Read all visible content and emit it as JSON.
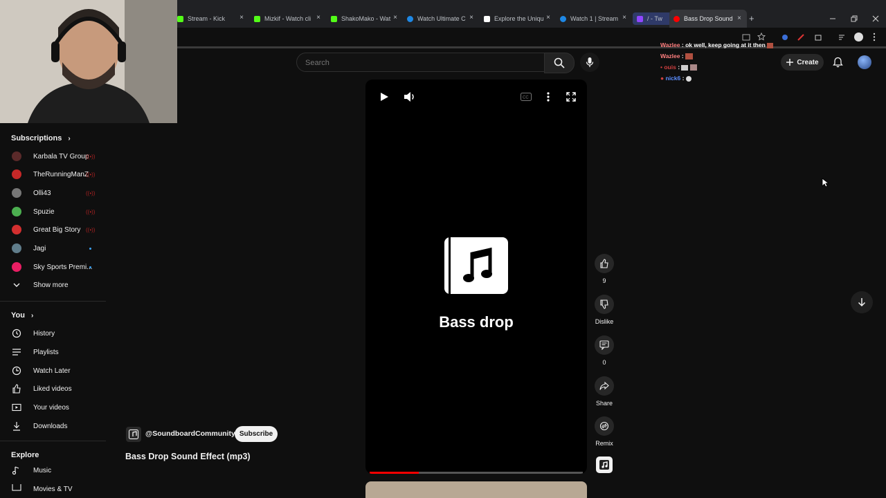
{
  "browser": {
    "tabs": [
      {
        "title": "Stream - Kick",
        "color": "#53fc18"
      },
      {
        "title": "Mizkif - Watch cli",
        "color": "#53fc18"
      },
      {
        "title": "ShakoMako - Wat",
        "color": "#53fc18"
      },
      {
        "title": "Watch Ultimate C",
        "color": "#1e88e5"
      },
      {
        "title": "Explore the Uniqu",
        "color": "#ffffff"
      },
      {
        "title": "Watch 1 | Stream",
        "color": "#1e88e5"
      },
      {
        "title": "/ - Tw",
        "color": "#9146ff"
      },
      {
        "title": "Bass Drop Sound",
        "color": "#ff0000"
      }
    ],
    "new_tab": "+",
    "close": "×"
  },
  "search": {
    "placeholder": "Search"
  },
  "header": {
    "create_label": "Create"
  },
  "sidebar": {
    "subscriptions_title": "Subscriptions",
    "subscriptions": [
      {
        "label": "Karbala TV Group",
        "indicator": "live",
        "color": "#5a2a2a"
      },
      {
        "label": "TheRunningManZ",
        "indicator": "live",
        "color": "#c62828"
      },
      {
        "label": "Olli43",
        "indicator": "live",
        "color": "#777777"
      },
      {
        "label": "Spuzie",
        "indicator": "live",
        "color": "#4caf50"
      },
      {
        "label": "Great Big Story",
        "indicator": "live",
        "color": "#d32f2f"
      },
      {
        "label": "Jagi",
        "indicator": "dot",
        "color": "#607d8b"
      },
      {
        "label": "Sky Sports Premi...",
        "indicator": "dot",
        "color": "#e91e63"
      }
    ],
    "show_more": "Show more",
    "you_title": "You",
    "you_items": [
      {
        "label": "History",
        "icon": "history-icon"
      },
      {
        "label": "Playlists",
        "icon": "playlists-icon"
      },
      {
        "label": "Watch Later",
        "icon": "clock-icon"
      },
      {
        "label": "Liked videos",
        "icon": "thumbs-up-icon"
      },
      {
        "label": "Your videos",
        "icon": "video-icon"
      },
      {
        "label": "Downloads",
        "icon": "download-icon"
      }
    ],
    "explore_title": "Explore",
    "explore_items": [
      {
        "label": "Music",
        "icon": "music-icon"
      },
      {
        "label": "Movies & TV",
        "icon": "film-icon"
      }
    ]
  },
  "player": {
    "overlay_title": "Bass drop",
    "progress_fraction": 0.23
  },
  "video": {
    "channel": "@SoundboardCommunity",
    "subscribe_label": "Subscribe",
    "title": "Bass Drop Sound Effect (mp3)"
  },
  "actions": {
    "like_count": "9",
    "dislike_label": "Dislike",
    "comments_count": "0",
    "share_label": "Share",
    "remix_label": "Remix"
  },
  "chat": [
    {
      "user": "Wazlee",
      "text": "ok well, keep going at it then",
      "color": "#ff7f7f"
    },
    {
      "user": "Wazlee",
      "text": "",
      "color": "#ff7f7f"
    },
    {
      "user": "ouis",
      "text": "",
      "color": "#d04040"
    },
    {
      "user": "nick6",
      "text": "",
      "color": "#5b8dff"
    }
  ],
  "colors": {
    "accent": "#ff0000",
    "background": "#0f0f0f"
  }
}
